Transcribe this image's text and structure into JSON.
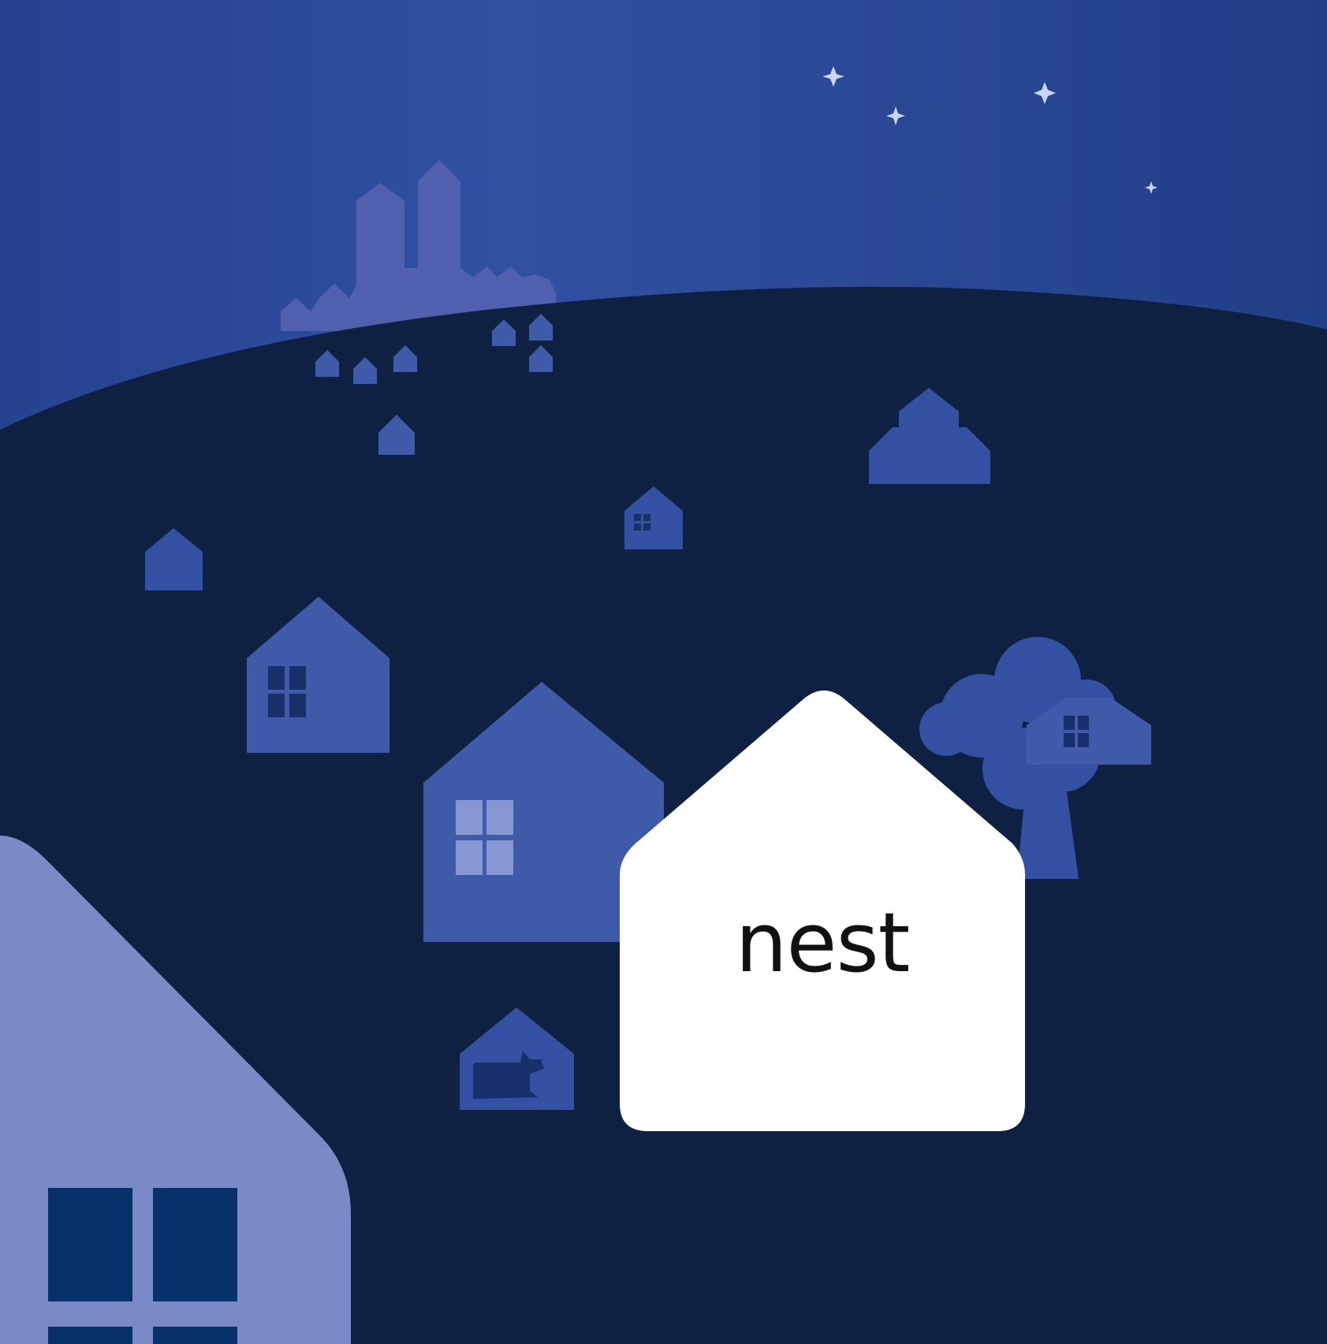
{
  "brand": {
    "logo_text": "nest"
  },
  "colors": {
    "sky_top": "#2f4d9e",
    "sky_bottom": "#213f86",
    "ground": "#0f2142",
    "far_castle": "#5060ae",
    "house_mid": "#3f5aa9",
    "house_dim": "#3350a2",
    "window_dark": "#15306b",
    "window_light": "#8797d3",
    "foreground_house": "#7a8ac6",
    "foreground_window": "#08306b",
    "logo_house": "#ffffff",
    "logo_text": "#111111",
    "star": "#c9d6ff"
  },
  "icons": [
    "star-icon",
    "castle-icon",
    "house-icon",
    "window-icon",
    "tree-icon",
    "dog-icon"
  ]
}
